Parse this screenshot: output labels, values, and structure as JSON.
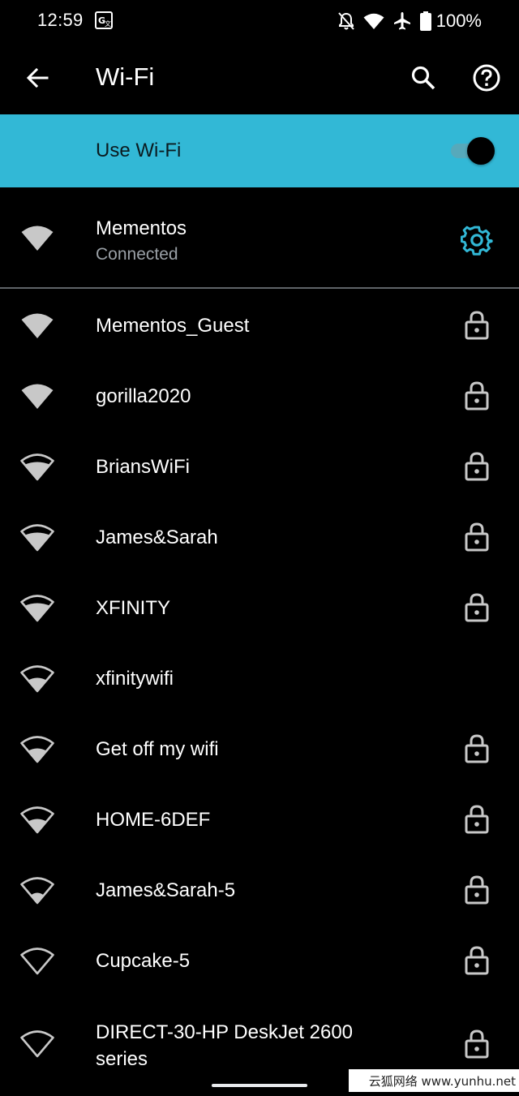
{
  "status_bar": {
    "time": "12:59",
    "battery": "100%",
    "icons": [
      "translate-icon",
      "notifications-off-icon",
      "wifi-status-icon",
      "airplane-icon",
      "battery-icon"
    ]
  },
  "app_bar": {
    "title": "Wi-Fi",
    "icons": [
      "back-arrow-icon",
      "search-icon",
      "help-icon"
    ]
  },
  "wifi_toggle": {
    "label": "Use Wi-Fi",
    "enabled": true,
    "accent_color": "#32b8d6"
  },
  "connected_network": {
    "name": "Mementos",
    "status": "Connected",
    "signal": 4,
    "icon": "gear-icon"
  },
  "networks": [
    {
      "name": "Mementos_Guest",
      "signal": 4,
      "secured": true
    },
    {
      "name": "gorilla2020",
      "signal": 4,
      "secured": true
    },
    {
      "name": "BriansWiFi",
      "signal": 3,
      "secured": true
    },
    {
      "name": "James&Sarah",
      "signal": 3,
      "secured": true
    },
    {
      "name": "XFINITY",
      "signal": 3,
      "secured": true
    },
    {
      "name": "xfinitywifi",
      "signal": 2,
      "secured": false
    },
    {
      "name": "Get off my wifi",
      "signal": 2,
      "secured": true
    },
    {
      "name": "HOME-6DEF",
      "signal": 2,
      "secured": true
    },
    {
      "name": "James&Sarah-5",
      "signal": 1,
      "secured": true
    },
    {
      "name": "Cupcake-5",
      "signal": 0,
      "secured": true
    },
    {
      "name": "DIRECT-30-HP DeskJet 2600",
      "name_line2": "series",
      "signal": 0,
      "secured": true
    }
  ],
  "watermark": "云狐网络 www.yunhu.net"
}
